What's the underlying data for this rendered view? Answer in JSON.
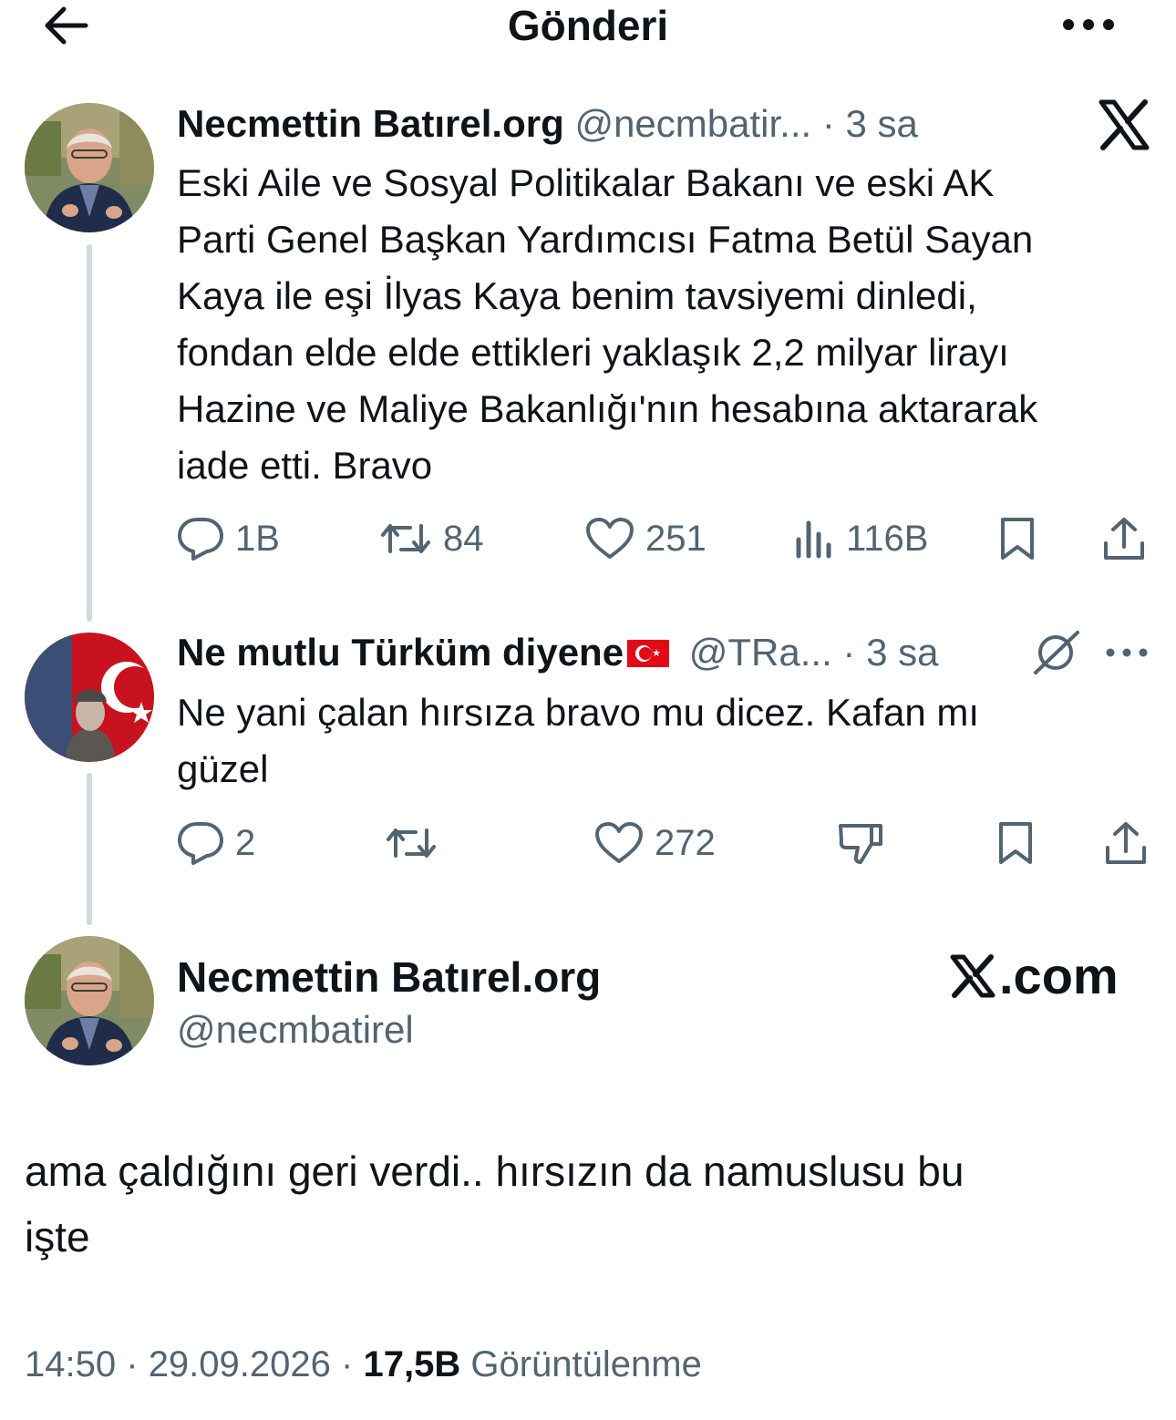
{
  "header": {
    "title": "Gönderi",
    "back_icon": "arrow-left-icon",
    "more_icon": "more-icon"
  },
  "tweet1": {
    "name": "Necmettin Batırel.org",
    "handle": "@necmbatir...",
    "sep": "·",
    "time": "3 sa",
    "text_lines": [
      "Eski Aile ve Sosyal Politikalar Bakanı ve eski AK",
      "Parti Genel Başkan Yardımcısı Fatma Betül Sayan",
      "Kaya ile eşi İlyas Kaya benim tavsiyemi dinledi,",
      "fondan elde  elde ettikleri yaklaşık 2,2 milyar lirayı",
      "Hazine ve Maliye Bakanlığı'nın hesabına aktararak",
      "iade etti. Bravo"
    ],
    "replies": "1B",
    "reposts": "84",
    "likes": "251",
    "views": "116B"
  },
  "tweet2": {
    "name": "Ne mutlu Türküm diyene",
    "flag": "🇹🇷",
    "handle": "@TRa...",
    "sep": "·",
    "time": "3 sa",
    "text_lines": [
      "Ne yani çalan hırsıza bravo mu dicez.  Kafan mı",
      "güzel"
    ],
    "replies": "2",
    "reposts": "",
    "likes": "272"
  },
  "main_tweet": {
    "name": "Necmettin Batırel.org",
    "handle": "@necmbatirel",
    "brand": ".com",
    "text_lines": [
      "ama çaldığını geri verdi.. hırsızın da namuslusu bu",
      "işte"
    ],
    "time": "14:50",
    "sep1": "·",
    "date": "29.09.2026",
    "sep2": "·",
    "views_count": "17,5B",
    "views_label": "Görüntülenme"
  },
  "colors": {
    "text": "#0f1419",
    "muted": "#536471",
    "line": "#cfd9de",
    "flag_red": "#e30a17"
  }
}
